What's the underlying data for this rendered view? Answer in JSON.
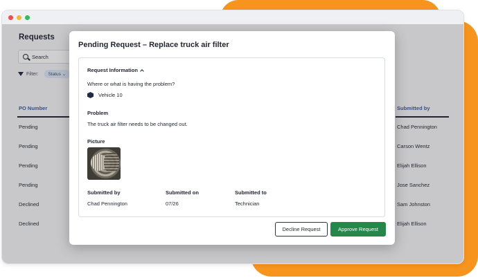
{
  "colors": {
    "accent_orange": "#f7941d",
    "approve_green": "#25884a",
    "header_blue": "#3c5d96"
  },
  "window": {
    "controls": [
      "close",
      "minimize",
      "maximize"
    ]
  },
  "page": {
    "title": "Requests",
    "search_placeholder": "Search",
    "filter_label": "Filter:",
    "filter_chip": "Status"
  },
  "table": {
    "left_header": "PO Number",
    "right_header": "Submitted by",
    "left_values": [
      "Pending",
      "Pending",
      "Pending",
      "Pending",
      "Declined",
      "Declined"
    ],
    "right_values": [
      "Chad Pennington",
      "Carson Wentz",
      "Elijah Ellison",
      "Jose Sanchez",
      "Sam Johnston",
      "Elijah Ellison"
    ]
  },
  "modal": {
    "title": "Pending Request – Replace truck air filter",
    "section_title": "Request Information",
    "question": "Where or what is having the problem?",
    "vehicle": "Vehicle 10",
    "problem_label": "Problem",
    "problem_text": "The truck air filter needs to be changed out.",
    "picture_label": "Picture",
    "meta": {
      "submitted_by_label": "Submitted by",
      "submitted_by_value": "Chad Pennington",
      "submitted_on_label": "Submitted on",
      "submitted_on_value": "07/26",
      "submitted_to_label": "Submitted to",
      "submitted_to_value": "Technician"
    },
    "decline_label": "Decline Request",
    "approve_label": "Approve Request"
  }
}
